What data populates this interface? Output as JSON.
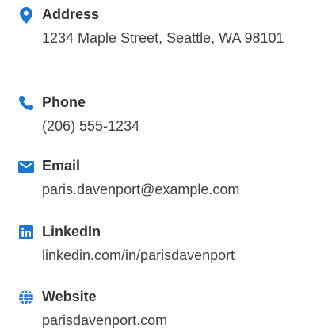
{
  "colors": {
    "accent": "#1976d2",
    "title_text": "#333333",
    "value_text": "#404040"
  },
  "contact": {
    "address": {
      "icon": "map-pin-icon",
      "title": "Address",
      "value": "1234 Maple Street, Seattle, WA 98101"
    },
    "phone": {
      "icon": "phone-icon",
      "title": "Phone",
      "value": "(206) 555-1234"
    },
    "email": {
      "icon": "envelope-icon",
      "title": "Email",
      "value": "paris.davenport@example.com"
    },
    "linkedin": {
      "icon": "linkedin-icon",
      "title": "LinkedIn",
      "value": "linkedin.com/in/parisdavenport"
    },
    "website": {
      "icon": "globe-icon",
      "title": "Website",
      "value": "parisdavenport.com"
    }
  }
}
